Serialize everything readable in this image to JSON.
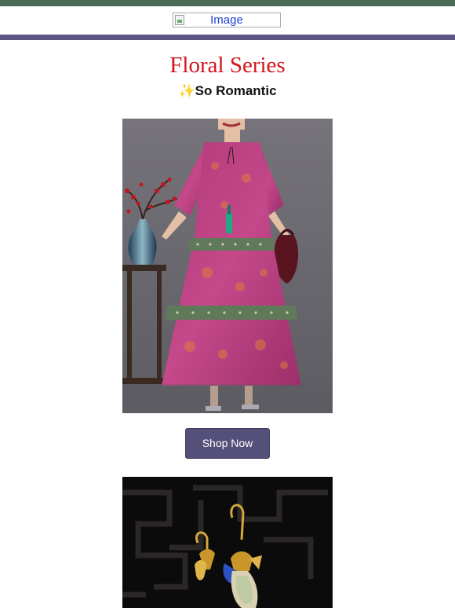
{
  "header": {
    "logo_alt": "Image"
  },
  "hero": {
    "title": "Floral Series",
    "subtitle": "✨So Romantic"
  },
  "cta": {
    "label": "Shop Now"
  },
  "colors": {
    "top_bar": "#4a6b57",
    "divider": "#5b5585",
    "title": "#d4141e",
    "button": "#545079"
  }
}
